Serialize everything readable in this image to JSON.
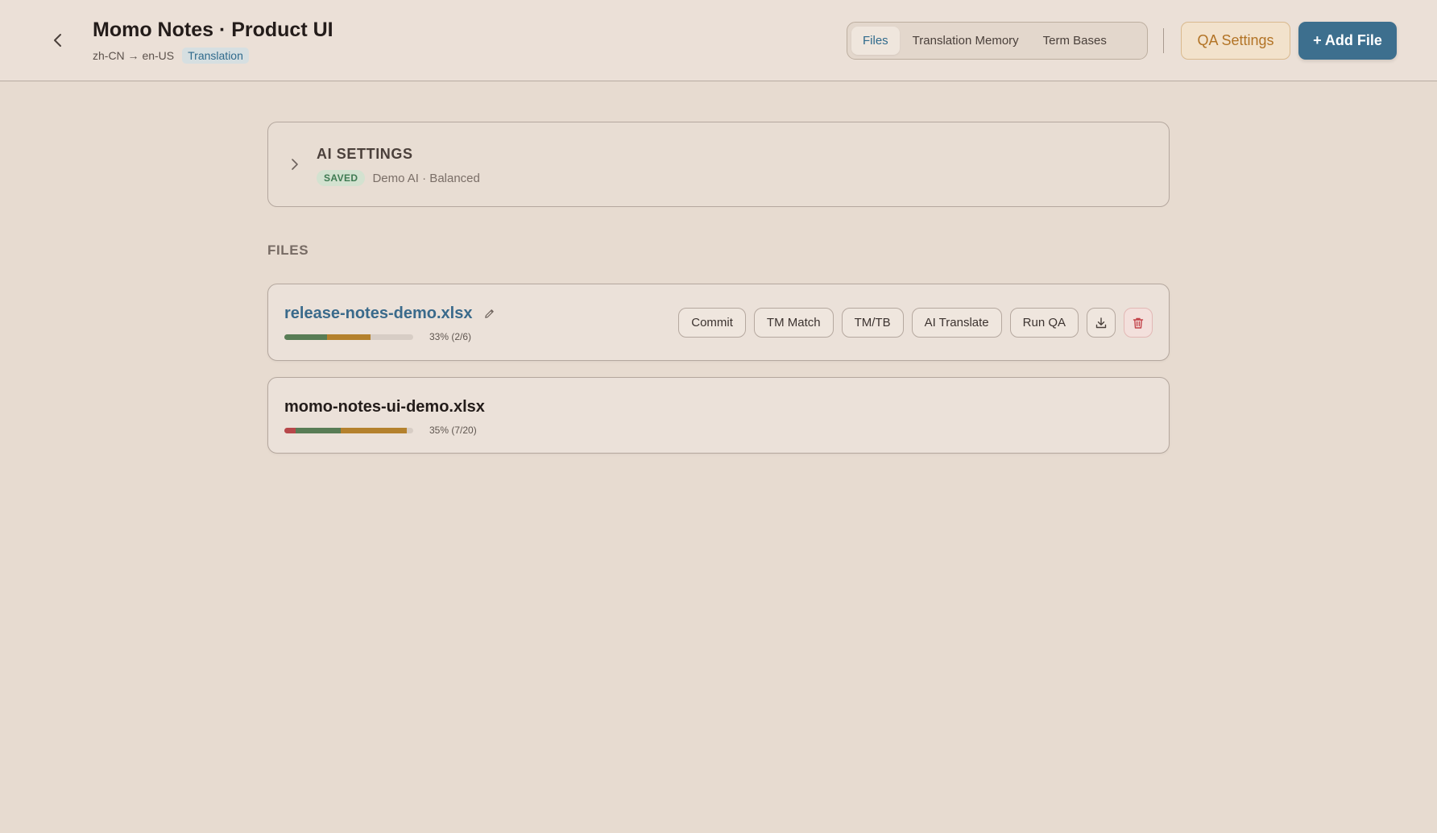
{
  "header": {
    "title": "Momo Notes · Product UI",
    "lang_pair": "zh-CN → en-US",
    "mode_badge": "Translation",
    "tabs": [
      {
        "label": "Files",
        "active": true
      },
      {
        "label": "Translation Memory",
        "active": false
      },
      {
        "label": "Term Bases",
        "active": false
      }
    ],
    "qa_settings_label": "QA Settings",
    "add_file_label": "+ Add File"
  },
  "ai_settings": {
    "title": "AI SETTINGS",
    "status_badge": "SAVED",
    "description": "Demo AI · Balanced"
  },
  "files_section": {
    "heading": "FILES",
    "files": [
      {
        "name": "release-notes-demo.xlsx",
        "progress_label": "33% (2/6)",
        "progress": {
          "error": 0,
          "done": 0.33,
          "draft": 0.34
        },
        "actions": [
          "Commit",
          "TM Match",
          "TM/TB",
          "AI Translate",
          "Run QA"
        ]
      },
      {
        "name": "momo-notes-ui-demo.xlsx",
        "progress_label": "35% (7/20)",
        "progress": {
          "error": 0.09,
          "done": 0.35,
          "draft": 0.51
        }
      }
    ]
  },
  "icons": {
    "back": "chevron-left-icon",
    "expand": "chevron-right-icon",
    "rename": "pencil-icon",
    "download": "download-icon",
    "delete": "trash-icon"
  },
  "colors": {
    "background": "#e7dbd0",
    "accent": "#3d6f8e",
    "qa_accent": "#b27325",
    "done": "#587c55",
    "draft": "#b4812d",
    "error": "#b7474a",
    "danger": "#c3434a"
  }
}
